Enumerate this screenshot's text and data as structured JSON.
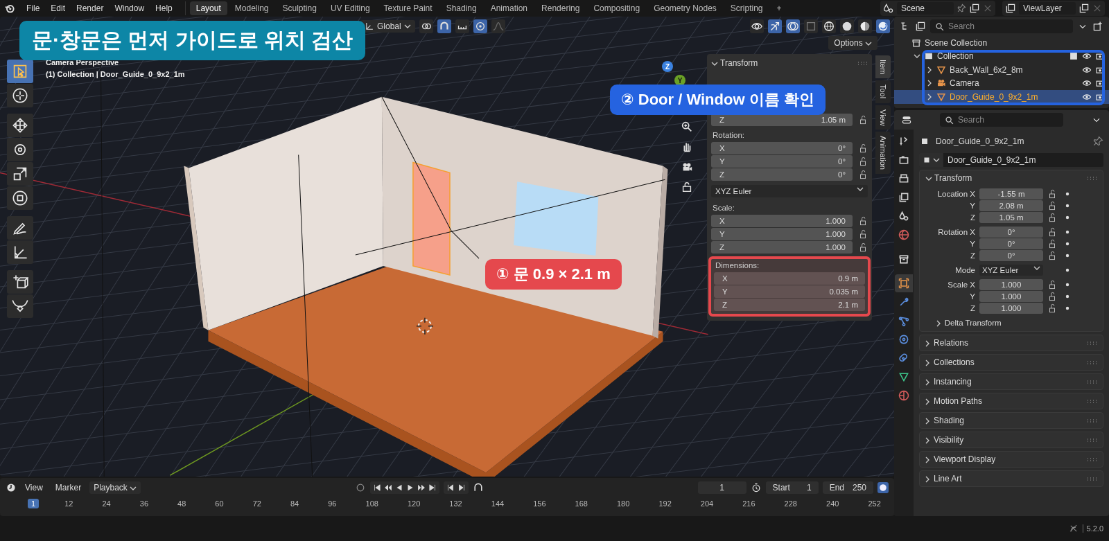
{
  "top_bar": {
    "menus": [
      "File",
      "Edit",
      "Render",
      "Window",
      "Help"
    ],
    "workspaces": [
      {
        "label": "Layout",
        "selected": true
      },
      {
        "label": "Modeling",
        "selected": false
      },
      {
        "label": "Sculpting",
        "selected": false
      },
      {
        "label": "UV Editing",
        "selected": false
      },
      {
        "label": "Texture Paint",
        "selected": false
      },
      {
        "label": "Shading",
        "selected": false
      },
      {
        "label": "Animation",
        "selected": false
      },
      {
        "label": "Rendering",
        "selected": false
      },
      {
        "label": "Compositing",
        "selected": false
      },
      {
        "label": "Geometry Nodes",
        "selected": false
      },
      {
        "label": "Scripting",
        "selected": false
      }
    ],
    "add_tab": "+",
    "scene": "Scene",
    "view_layer": "ViewLayer"
  },
  "viewport": {
    "orientation": "Global",
    "options_button": "Options",
    "view_name": "Camera Perspective",
    "object_info": "(1) Collection | Door_Guide_0_9x2_1m",
    "gizmo_axes": [
      {
        "label": "Z",
        "color": "#3b82e0"
      },
      {
        "label": "Y",
        "color": "#6aa126"
      }
    ],
    "tools": [
      {
        "kind": "select",
        "selected": true
      },
      {
        "kind": "cursor",
        "selected": false
      },
      {
        "kind": "move",
        "selected": false
      },
      {
        "kind": "rotate",
        "selected": false
      },
      {
        "kind": "scale",
        "selected": false
      },
      {
        "kind": "transform",
        "selected": false
      },
      {
        "kind": "annotate",
        "selected": false
      },
      {
        "kind": "measure",
        "selected": false
      },
      {
        "kind": "add_cube",
        "selected": false
      },
      {
        "kind": "extrude",
        "selected": false
      }
    ],
    "side_tabs": [
      {
        "label": "Item",
        "selected": true
      },
      {
        "label": "Tool",
        "selected": false
      },
      {
        "label": "View",
        "selected": false
      },
      {
        "label": "Animation",
        "selected": false
      }
    ]
  },
  "n_panel": {
    "title": "Transform",
    "groups": [
      {
        "kind": "fields",
        "rows": [
          {
            "axis": "Z",
            "value": "1.05 m"
          }
        ]
      },
      {
        "kind": "fields",
        "label": "Rotation:",
        "rows": [
          {
            "axis": "X",
            "value": "0°"
          },
          {
            "axis": "Y",
            "value": "0°"
          },
          {
            "axis": "Z",
            "value": "0°"
          }
        ]
      },
      {
        "kind": "dropdown",
        "value": "XYZ Euler"
      },
      {
        "kind": "fields",
        "label": "Scale:",
        "rows": [
          {
            "axis": "X",
            "value": "1.000"
          },
          {
            "axis": "Y",
            "value": "1.000"
          },
          {
            "axis": "Z",
            "value": "1.000"
          }
        ]
      },
      {
        "kind": "dimensions",
        "label": "Dimensions:",
        "rows": [
          {
            "axis": "X",
            "value": "0.9 m"
          },
          {
            "axis": "Y",
            "value": "0.035 m"
          },
          {
            "axis": "Z",
            "value": "2.1 m"
          }
        ]
      }
    ]
  },
  "annotations": [
    {
      "kind": "title",
      "text": "문·창문은 먼저 가이드로 위치 검산",
      "color": "#0d86a6"
    },
    {
      "kind": "outliner",
      "text": "② Door / Window 이름 확인",
      "color": "#2563e0"
    },
    {
      "kind": "dimensions",
      "text": "① 문 0.9 × 2.1 m",
      "color": "#e5484d"
    }
  ],
  "outliner": {
    "search_placeholder": "Search",
    "tree": [
      {
        "label": "Scene Collection",
        "kind": "scene",
        "selected": false,
        "children": [
          {
            "label": "Collection",
            "kind": "collection",
            "expanded": true,
            "selected": false,
            "children": [
              {
                "label": "Back_Wall_6x2_8m",
                "kind": "mesh",
                "expanded": false,
                "selected": false
              },
              {
                "label": "Camera",
                "kind": "camera",
                "expanded": false,
                "selected": false
              },
              {
                "label": "Door_Guide_0_9x2_1m",
                "kind": "mesh",
                "expanded": false,
                "selected": true
              }
            ]
          }
        ]
      }
    ]
  },
  "properties": {
    "search_placeholder": "Search",
    "tabs": [
      {
        "kind": "tool",
        "selected": false
      },
      {
        "kind": "render",
        "selected": false
      },
      {
        "kind": "output",
        "selected": false
      },
      {
        "kind": "view_layer",
        "selected": false
      },
      {
        "kind": "scene",
        "selected": false
      },
      {
        "kind": "world",
        "selected": false
      },
      {
        "kind": "collection",
        "selected": false
      },
      {
        "kind": "object",
        "selected": true
      },
      {
        "kind": "modifiers",
        "selected": false
      },
      {
        "kind": "particles",
        "selected": false
      },
      {
        "kind": "physics",
        "selected": false
      },
      {
        "kind": "constraints",
        "selected": false
      },
      {
        "kind": "data",
        "selected": false
      },
      {
        "kind": "material",
        "selected": false
      }
    ],
    "object_name": "Door_Guide_0_9x2_1m",
    "data_name": "Door_Guide_0_9x2_1m",
    "transform": {
      "title": "Transform",
      "expanded": true,
      "groups": [
        {
          "kind": "fields",
          "rows": [
            {
              "label": "Location X",
              "value": "-1.55 m"
            },
            {
              "label": "Y",
              "value": "2.08 m"
            },
            {
              "label": "Z",
              "value": "1.05 m"
            }
          ]
        },
        {
          "kind": "fields",
          "rows": [
            {
              "label": "Rotation X",
              "value": "0°"
            },
            {
              "label": "Y",
              "value": "0°"
            },
            {
              "label": "Z",
              "value": "0°"
            }
          ]
        },
        {
          "kind": "dropdown",
          "rows": [
            {
              "label": "Mode",
              "value": "XYZ Euler"
            }
          ]
        },
        {
          "kind": "fields",
          "rows": [
            {
              "label": "Scale X",
              "value": "1.000"
            },
            {
              "label": "Y",
              "value": "1.000"
            },
            {
              "label": "Z",
              "value": "1.000"
            }
          ]
        }
      ],
      "subpanel": {
        "title": "Delta Transform",
        "expanded": false
      }
    },
    "panels": [
      {
        "title": "Relations",
        "expanded": false
      },
      {
        "title": "Collections",
        "expanded": false
      },
      {
        "title": "Instancing",
        "expanded": false
      },
      {
        "title": "Motion Paths",
        "expanded": false
      },
      {
        "title": "Shading",
        "expanded": false
      },
      {
        "title": "Visibility",
        "expanded": false
      },
      {
        "title": "Viewport Display",
        "expanded": false
      },
      {
        "title": "Line Art",
        "expanded": false
      }
    ]
  },
  "timeline": {
    "menus": [
      {
        "label": "View",
        "kind": "menu"
      },
      {
        "label": "Marker",
        "kind": "menu"
      },
      {
        "label": "Playback",
        "kind": "dropdown"
      }
    ],
    "current_frame": "1",
    "start_label": "Start",
    "start": "1",
    "end_label": "End",
    "end": "250",
    "ticks": [
      {
        "label": "1",
        "selected": true
      },
      {
        "label": "12",
        "selected": false
      },
      {
        "label": "24",
        "selected": false
      },
      {
        "label": "36",
        "selected": false
      },
      {
        "label": "48",
        "selected": false
      },
      {
        "label": "60",
        "selected": false
      },
      {
        "label": "72",
        "selected": false
      },
      {
        "label": "84",
        "selected": false
      },
      {
        "label": "96",
        "selected": false
      },
      {
        "label": "108",
        "selected": false
      },
      {
        "label": "120",
        "selected": false
      },
      {
        "label": "132",
        "selected": false
      },
      {
        "label": "144",
        "selected": false
      },
      {
        "label": "156",
        "selected": false
      },
      {
        "label": "168",
        "selected": false
      },
      {
        "label": "180",
        "selected": false
      },
      {
        "label": "192",
        "selected": false
      },
      {
        "label": "204",
        "selected": false
      },
      {
        "label": "216",
        "selected": false
      },
      {
        "label": "228",
        "selected": false
      },
      {
        "label": "240",
        "selected": false
      },
      {
        "label": "252",
        "selected": false
      }
    ]
  },
  "status_bar": {
    "version": "5.2.0"
  }
}
